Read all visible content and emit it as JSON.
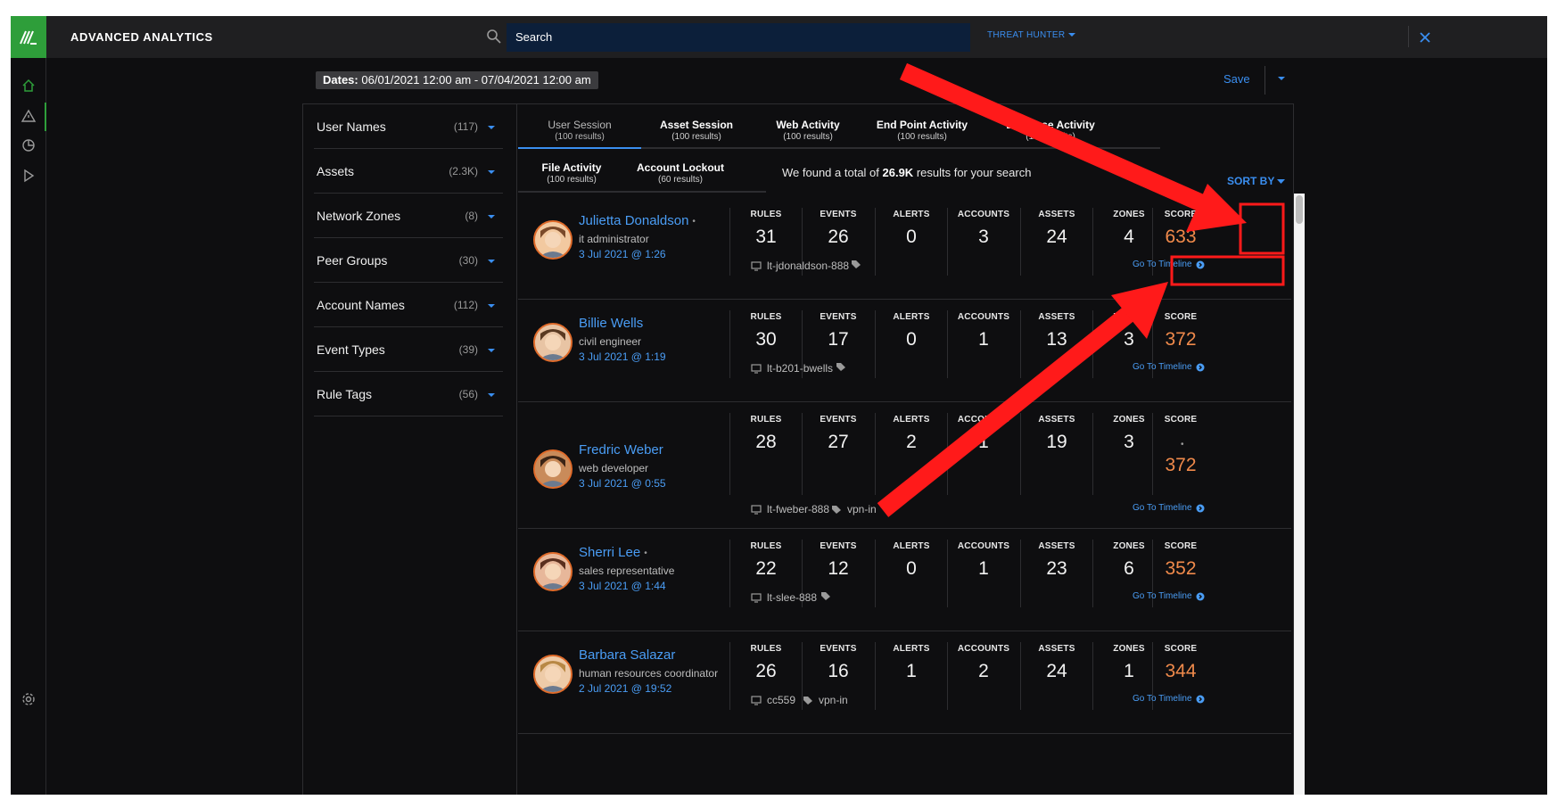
{
  "app": {
    "title": "ADVANCED ANALYTICS",
    "search_placeholder": "Search",
    "menu": "THREAT HUNTER"
  },
  "datebar": {
    "label": "Dates:",
    "range": "06/01/2021 12:00 am - 07/04/2021 12:00 am",
    "save_label": "Save"
  },
  "filters": [
    {
      "label": "User Names",
      "count": "(117)"
    },
    {
      "label": "Assets",
      "count": "(2.3K)"
    },
    {
      "label": "Network Zones",
      "count": "(8)"
    },
    {
      "label": "Peer Groups",
      "count": "(30)"
    },
    {
      "label": "Account Names",
      "count": "(112)"
    },
    {
      "label": "Event Types",
      "count": "(39)"
    },
    {
      "label": "Rule Tags",
      "count": "(56)"
    }
  ],
  "tabs": [
    {
      "label": "User Session",
      "sub": "(100 results)"
    },
    {
      "label": "Asset Session",
      "sub": "(100 results)"
    },
    {
      "label": "Web Activity",
      "sub": "(100 results)"
    },
    {
      "label": "End Point Activity",
      "sub": "(100 results)"
    },
    {
      "label": "Database Activity",
      "sub": "(100 results)"
    },
    {
      "label": "File Activity",
      "sub": "(100 results)"
    },
    {
      "label": "Account Lockout",
      "sub": "(60 results)"
    }
  ],
  "summary": {
    "prefix": "We found a total of ",
    "total": "26.9K",
    "suffix": " results for your search"
  },
  "sort_label": "SORT BY",
  "stat_labels": [
    "RULES",
    "EVENTS",
    "ALERTS",
    "ACCOUNTS",
    "ASSETS",
    "ZONES",
    "SCORE"
  ],
  "timeline_label": "Go To Timeline",
  "results": [
    {
      "name": "Julietta Donaldson",
      "dot": "•",
      "role": "it administrator",
      "date": "3 Jul 2021 @ 1:26",
      "rules": "31",
      "events": "26",
      "alerts": "0",
      "accounts": "3",
      "assets": "24",
      "zones": "4",
      "score": "633",
      "host": "lt-jdonaldson-888",
      "tag": ""
    },
    {
      "name": "Billie Wells",
      "dot": "",
      "role": "civil engineer",
      "date": "3 Jul 2021 @ 1:19",
      "rules": "30",
      "events": "17",
      "alerts": "0",
      "accounts": "1",
      "assets": "13",
      "zones": "3",
      "score": "372",
      "host": "lt-b201-bwells",
      "tag": ""
    },
    {
      "name": "Fredric Weber",
      "dot": "",
      "role": "web developer",
      "date": "3 Jul 2021 @ 0:55",
      "rules": "28",
      "events": "27",
      "alerts": "2",
      "accounts": "1",
      "assets": "19",
      "zones": "3",
      "score": "372",
      "score_dot": "•",
      "host": "lt-fweber-888",
      "tag": "vpn-in"
    },
    {
      "name": "Sherri Lee",
      "dot": "•",
      "role": "sales representative",
      "date": "3 Jul 2021 @ 1:44",
      "rules": "22",
      "events": "12",
      "alerts": "0",
      "accounts": "1",
      "assets": "23",
      "zones": "6",
      "score": "352",
      "host": "lt-slee-888",
      "tag": ""
    },
    {
      "name": "Barbara Salazar",
      "dot": "",
      "role": "human resources coordinator",
      "date": "2 Jul 2021 @ 19:52",
      "rules": "26",
      "events": "16",
      "alerts": "1",
      "accounts": "2",
      "assets": "24",
      "zones": "1",
      "score": "344",
      "host": "cc559",
      "tag": "vpn-in"
    }
  ],
  "colors": {
    "accent": "#3a8ef0",
    "brand": "#2e9e3a",
    "score": "#f08a4b",
    "annotation": "#ff1a1a"
  }
}
